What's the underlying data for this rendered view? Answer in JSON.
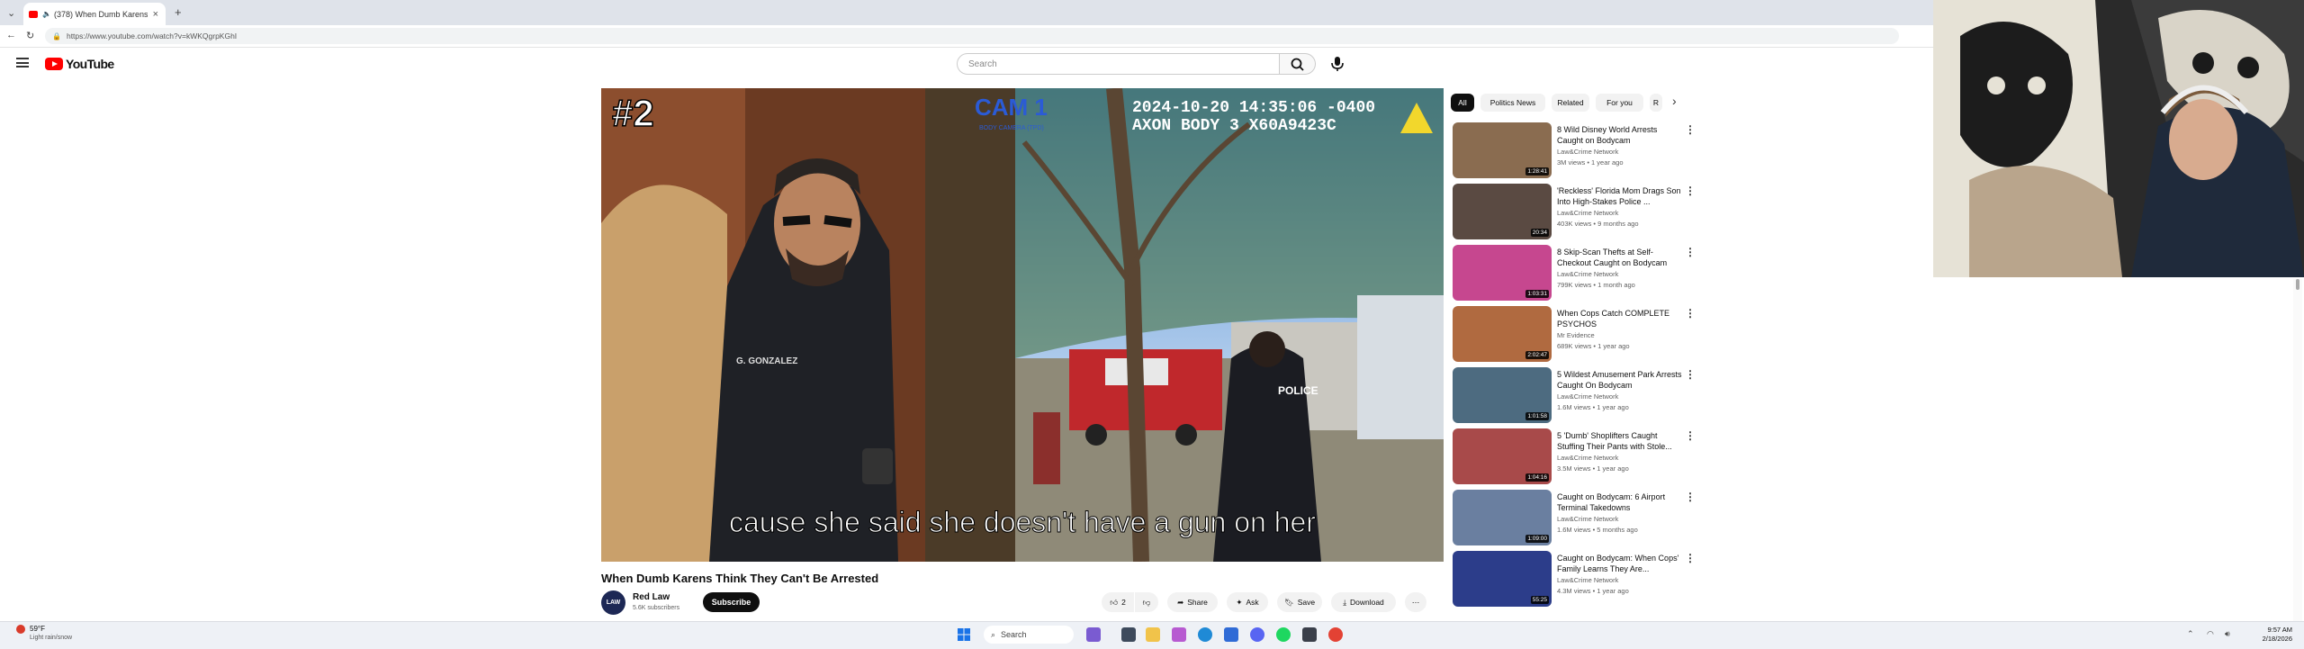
{
  "browser": {
    "tab_title": "(378) When Dumb Karens Thi",
    "url": "https://www.youtube.com/watch?v=kWKQgrpKGhI",
    "new_tab_symbol": "+",
    "back_symbol": "←",
    "reload_symbol": "↻"
  },
  "youtube": {
    "logo_text": "YouTube",
    "search_placeholder": "Search"
  },
  "video": {
    "overlay_number": "#2",
    "cam_label": "CAM 1",
    "cam_sublabel": "BODY CAMERA (TPD)",
    "timestamp": "2024-10-20 14:35:06 -0400",
    "device": "AXON BODY 3 X60A9423C",
    "badge_name": "G. GONZALEZ",
    "police_label": "POLICE",
    "caption": "cause she said she doesn't have a gun on her",
    "title": "When Dumb Karens Think They Can't Be Arrested"
  },
  "channel": {
    "name": "Red Law",
    "subscribers": "5.6K subscribers",
    "avatar_text": "LAW",
    "subscribe_label": "Subscribe"
  },
  "actions": {
    "like_count": "2",
    "share_label": "Share",
    "ask_label": "Ask",
    "save_label": "Save",
    "download_label": "Download"
  },
  "chips": [
    "All",
    "Politics News",
    "Related",
    "For you",
    "R"
  ],
  "related": [
    {
      "title": "8 Wild Disney World Arrests Caught on Bodycam",
      "channel": "Law&Crime Network",
      "meta": "3M views • 1 year ago",
      "duration": "1:28:41",
      "thumb_color": "#8a6c50"
    },
    {
      "title": "'Reckless' Florida Mom Drags Son Into High-Stakes Police ...",
      "channel": "Law&Crime Network",
      "meta": "403K views • 9 months ago",
      "duration": "20:34",
      "thumb_color": "#5a4a42"
    },
    {
      "title": "8 Skip-Scan Thefts at Self-Checkout Caught on Bodycam",
      "channel": "Law&Crime Network",
      "meta": "799K views • 1 month ago",
      "duration": "1:03:31",
      "thumb_color": "#c6478f"
    },
    {
      "title": "When Cops Catch COMPLETE PSYCHOS",
      "channel": "Mr Evidence",
      "meta": "689K views • 1 year ago",
      "duration": "2:02:47",
      "thumb_color": "#b06a40"
    },
    {
      "title": "5 Wildest Amusement Park Arrests Caught On Bodycam",
      "channel": "Law&Crime Network",
      "meta": "1.6M views • 1 year ago",
      "duration": "1:01:58",
      "thumb_color": "#4d6b80"
    },
    {
      "title": "5 'Dumb' Shoplifters Caught Stuffing Their Pants with Stole...",
      "channel": "Law&Crime Network",
      "meta": "3.5M views • 1 year ago",
      "duration": "1:04:16",
      "thumb_color": "#a84a4a"
    },
    {
      "title": "Caught on Bodycam: 6 Airport Terminal Takedowns",
      "channel": "Law&Crime Network",
      "meta": "1.6M views • 5 months ago",
      "duration": "1:09:00",
      "thumb_color": "#6a7fa0"
    },
    {
      "title": "Caught on Bodycam: When Cops' Family Learns They Are...",
      "channel": "Law&Crime Network",
      "meta": "4.3M views • 1 year ago",
      "duration": "55:25",
      "thumb_color": "#2c3d8a"
    }
  ],
  "taskbar": {
    "weather_temp": "59°F",
    "weather_text": "Light rain/snow",
    "search_label": "Search",
    "time": "9:57 AM",
    "date": "2/18/2026"
  },
  "colors": {
    "youtube_red": "#ff0000",
    "subscribe_bg": "#0f0f0f",
    "page_bg": "#ffffff",
    "taskbar_bg": "#eef1f6"
  }
}
